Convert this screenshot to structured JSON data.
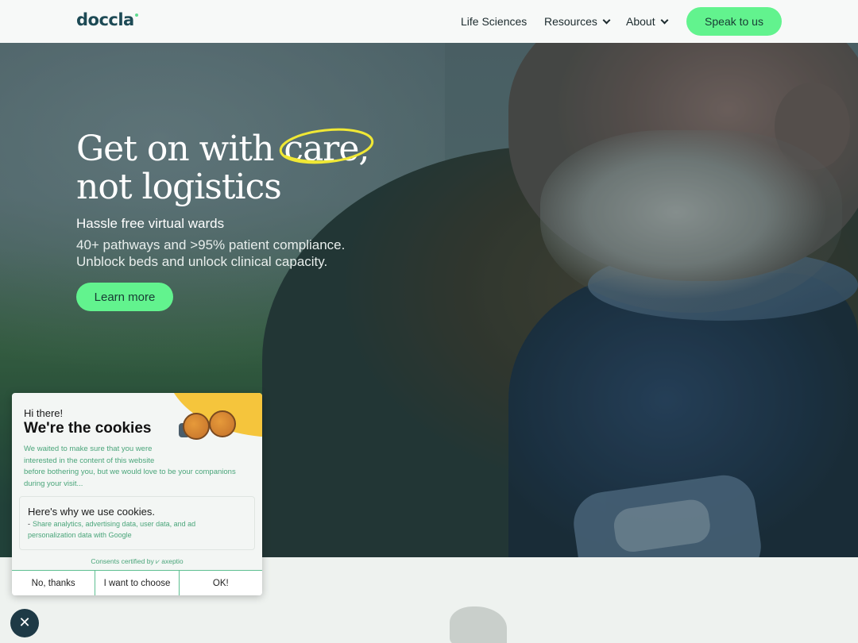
{
  "nav": {
    "logo": "doccla",
    "items": [
      {
        "label": "Life Sciences",
        "has_dropdown": false
      },
      {
        "label": "Resources",
        "has_dropdown": true
      },
      {
        "label": "About",
        "has_dropdown": true
      }
    ],
    "cta_label": "Speak to us"
  },
  "hero": {
    "headline_line1_before": "Get on with ",
    "headline_line1_circled": "care",
    "headline_line1_after": ",",
    "headline_line2": "not logistics",
    "subhead": "Hassle free virtual wards",
    "desc_line1": "40+ pathways and >95% patient compliance.",
    "desc_line2": "Unblock beds and unlock clinical capacity.",
    "button_label": "Learn more"
  },
  "cookie": {
    "greeting": "Hi there!",
    "title": "We're the cookies",
    "intro_lines": [
      "We waited to make sure that you were",
      "interested in the content of this website",
      "before bothering you, but we would love to be your companions",
      "during your visit..."
    ],
    "why_title": "Here's why we use cookies.",
    "why_dash": "-",
    "why_item": "Share analytics, advertising data, user data, and ad personalization data with Google",
    "certified": "Consents certified by ⩗ axeptio",
    "buttons": {
      "no": "No, thanks",
      "choose": "I want to choose",
      "ok": "OK!"
    },
    "close_glyph": "✕"
  },
  "colors": {
    "accent_green": "#62f38e",
    "brand_dark": "#1d4a55",
    "cookie_text_green": "#4aa57a",
    "highlight_yellow": "#f0e835"
  }
}
